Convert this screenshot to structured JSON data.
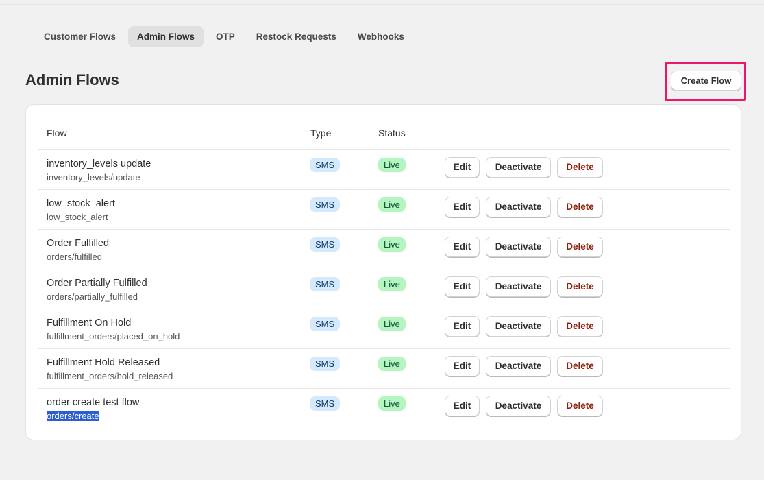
{
  "tabs": [
    {
      "label": "Customer Flows",
      "active": false
    },
    {
      "label": "Admin Flows",
      "active": true
    },
    {
      "label": "OTP",
      "active": false
    },
    {
      "label": "Restock Requests",
      "active": false
    },
    {
      "label": "Webhooks",
      "active": false
    }
  ],
  "page": {
    "title": "Admin Flows",
    "create_button": "Create Flow"
  },
  "table": {
    "headers": {
      "flow": "Flow",
      "type": "Type",
      "status": "Status"
    },
    "actions": {
      "edit": "Edit",
      "deactivate": "Deactivate",
      "delete": "Delete"
    },
    "rows": [
      {
        "name": "inventory_levels update",
        "topic": "inventory_levels/update",
        "type": "SMS",
        "status": "Live"
      },
      {
        "name": "low_stock_alert",
        "topic": "low_stock_alert",
        "type": "SMS",
        "status": "Live"
      },
      {
        "name": "Order Fulfilled",
        "topic": "orders/fulfilled",
        "type": "SMS",
        "status": "Live"
      },
      {
        "name": "Order Partially Fulfilled",
        "topic": "orders/partially_fulfilled",
        "type": "SMS",
        "status": "Live"
      },
      {
        "name": "Fulfillment On Hold",
        "topic": "fulfillment_orders/placed_on_hold",
        "type": "SMS",
        "status": "Live"
      },
      {
        "name": "Fulfillment Hold Released",
        "topic": "fulfillment_orders/hold_released",
        "type": "SMS",
        "status": "Live"
      },
      {
        "name": "order create test flow",
        "topic": "orders/create",
        "type": "SMS",
        "status": "Live"
      }
    ]
  },
  "colors": {
    "highlight": "#e8196a",
    "type_badge": "#d4e9fb",
    "status_badge": "#b4f5c1",
    "delete_text": "#8e1f0b",
    "selection": "#2b5fd0"
  }
}
